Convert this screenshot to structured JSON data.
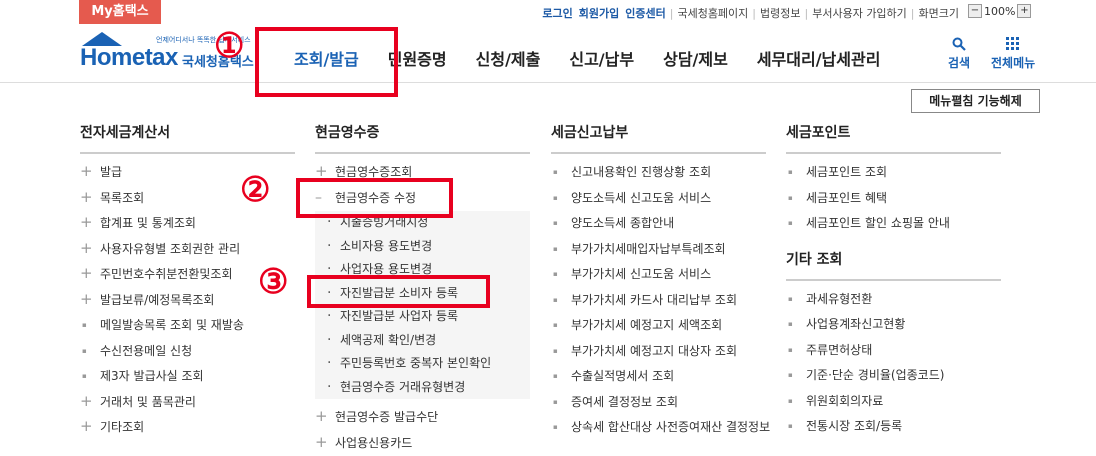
{
  "topbar": {
    "my_hometax": "My홈택스",
    "links": [
      "로그인",
      "회원가입",
      "인증센터",
      "국세청홈페이지",
      "법령정보",
      "부서사용자 가입하기",
      "화면크기"
    ],
    "zoom_minus": "−",
    "zoom_value": "100%",
    "zoom_plus": "+"
  },
  "logo": {
    "home": "Hom",
    "tax": "etax",
    "tagline": "언제어디서나 똑똑한 납세서비스",
    "korean": "국세청홈택스"
  },
  "gnb": [
    "조회/발급",
    "민원증명",
    "신청/제출",
    "신고/납부",
    "상담/제보",
    "세무대리/납세관리"
  ],
  "header_icons": {
    "search": "검색",
    "all_menu": "전체메뉴"
  },
  "menu_release": "메뉴펼침 기능해제",
  "annotations": [
    "①",
    "②",
    "③"
  ],
  "columns": [
    {
      "title": "전자세금계산서",
      "items": [
        "발급",
        "목록조회",
        "합계표 및 통계조회",
        "사용자유형별 조회권한 관리",
        "주민번호수취분전환및조회",
        "발급보류/예정목록조회",
        "메일발송목록 조회 및 재발송",
        "수신전용메일 신청",
        "제3자 발급사실 조회",
        "거래처 및 품목관리",
        "기타조회"
      ]
    },
    {
      "title": "현금영수증",
      "items": [
        "현금영수증조회",
        "현금영수증 수정"
      ],
      "sub_items": [
        "지출증빙거래지정",
        "소비자용 용도변경",
        "사업자용 용도변경",
        "자진발급분 소비자 등록",
        "자진발급분 사업자 등록",
        "세액공제 확인/변경",
        "주민등록번호 중복자 본인확인",
        "현금영수증 거래유형변경"
      ],
      "after_items": [
        "현금영수증 발급수단",
        "사업용신용카드"
      ]
    },
    {
      "title": "세금신고납부",
      "items": [
        "신고내용확인 진행상황 조회",
        "양도소득세 신고도움 서비스",
        "양도소득세 종합안내",
        "부가가치세매입자납부특례조회",
        "부가가치세 신고도움 서비스",
        "부가가치세 카드사 대리납부 조회",
        "부가가치세 예정고지 세액조회",
        "부가가치세 예정고지 대상자 조회",
        "수출실적명세서 조회",
        "증여세 결정정보 조회",
        "상속세 합산대상 사전증여재산 결정정보"
      ]
    },
    {
      "title": "세금포인트",
      "items": [
        "세금포인트 조회",
        "세금포인트 혜택",
        "세금포인트 할인 쇼핑몰 안내"
      ],
      "title2": "기타 조회",
      "items2": [
        "과세유형전환",
        "사업용계좌신고현황",
        "주류면허상태",
        "기준·단순 경비율(업종코드)",
        "위원회회의자료",
        "전통시장 조회/등록"
      ]
    }
  ]
}
